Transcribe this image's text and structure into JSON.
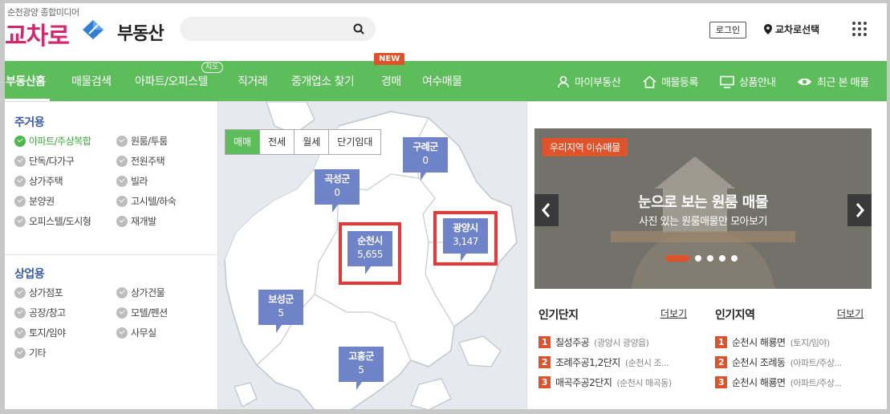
{
  "header": {
    "tagline": "순천광양 종합미디어",
    "logo_text": "교차로",
    "logo_sub": "부동산",
    "login_label": "로그인",
    "region_label": "교차로선택"
  },
  "nav": {
    "items": [
      "부동산홈",
      "매물검색",
      "아파트/오피스텔",
      "직거래",
      "중개업소 찾기",
      "경매",
      "여수매물"
    ],
    "new_badge": "NEW",
    "map_badge": "지도",
    "right": [
      "마이부동산",
      "매물등록",
      "상품안내",
      "최근 본 매물"
    ]
  },
  "categories": {
    "residential_title": "주거용",
    "residential": [
      "아파트/주상복합",
      "원룸/투룸",
      "단독/다가구",
      "전원주택",
      "상가주택",
      "빌라",
      "분양권",
      "고시텔/하숙",
      "오피스텔/도시형",
      "재개발"
    ],
    "commercial_title": "상업용",
    "commercial": [
      "상가점포",
      "상가건물",
      "공장/창고",
      "모텔/펜션",
      "토지/임야",
      "사무실",
      "기타"
    ]
  },
  "map": {
    "tabs": [
      "매매",
      "전세",
      "월세",
      "단기임대"
    ],
    "markers": [
      {
        "name": "구례군",
        "count": "0"
      },
      {
        "name": "곡성군",
        "count": "0"
      },
      {
        "name": "순천시",
        "count": "5,655"
      },
      {
        "name": "광양시",
        "count": "3,147"
      },
      {
        "name": "보성군",
        "count": "5"
      },
      {
        "name": "고흥군",
        "count": "5"
      }
    ]
  },
  "banner": {
    "badge": "우리지역 이슈매물",
    "title": "눈으로 보는 원룸 매물",
    "subtitle": "사진 있는 원룸매물만 모아보기"
  },
  "popular_complex": {
    "title": "인기단지",
    "more": "더보기",
    "items": [
      {
        "rank": "1",
        "name": "칠성주공",
        "sub": "(광양시 광양읍)"
      },
      {
        "rank": "2",
        "name": "조례주공1,2단지",
        "sub": "(순천시 조..."
      },
      {
        "rank": "3",
        "name": "매곡주공2단지",
        "sub": "(순천시 매곡동)"
      }
    ]
  },
  "popular_region": {
    "title": "인기지역",
    "more": "더보기",
    "items": [
      {
        "rank": "1",
        "name": "순천시 해룡면",
        "sub": "(토지/임야)"
      },
      {
        "rank": "2",
        "name": "순천시 조례동",
        "sub": "(아파트/주상..."
      },
      {
        "rank": "3",
        "name": "순천시 해룡면",
        "sub": "(아파트/주상..."
      }
    ]
  },
  "colors": {
    "nav_green": "#5cbd5a",
    "logo_pink": "#d6266e",
    "accent_orange": "#e0522a",
    "marker_blue": "#6e83c8",
    "highlight_red": "#e8363a"
  }
}
